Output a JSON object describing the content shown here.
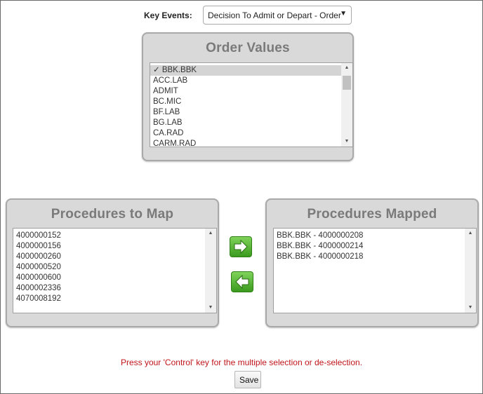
{
  "key_events": {
    "label": "Key Events:",
    "selected": "Decision To Admit or Depart - Order"
  },
  "order_values": {
    "title": "Order Values",
    "items": [
      {
        "label": "✓ BBK.BBK",
        "selected": true
      },
      {
        "label": "ACC.LAB",
        "selected": false
      },
      {
        "label": "ADMIT",
        "selected": false
      },
      {
        "label": "BC.MIC",
        "selected": false
      },
      {
        "label": "BF.LAB",
        "selected": false
      },
      {
        "label": "BG.LAB",
        "selected": false
      },
      {
        "label": "CA.RAD",
        "selected": false
      },
      {
        "label": "CARM.RAD",
        "selected": false
      }
    ]
  },
  "procedures_to_map": {
    "title": "Procedures to Map",
    "items": [
      "4000000152",
      "4000000156",
      "4000000260",
      "4000000520",
      "4000000600",
      "4000002336",
      "4070008192"
    ]
  },
  "procedures_mapped": {
    "title": "Procedures Mapped",
    "items": [
      "BBK.BBK - 4000000208",
      "BBK.BBK - 4000000214",
      "BBK.BBK - 4000000218"
    ]
  },
  "icons": {
    "add": "arrow-right-icon",
    "remove": "arrow-left-icon"
  },
  "colors": {
    "hint": "#c0151b",
    "button_green": "#4caf2a",
    "panel_bg": "#d9d9d9",
    "title_gray": "#7a7a7a"
  },
  "hint_text": "Press your 'Control' key for the multiple selection or de-selection.",
  "save_label": "Save"
}
